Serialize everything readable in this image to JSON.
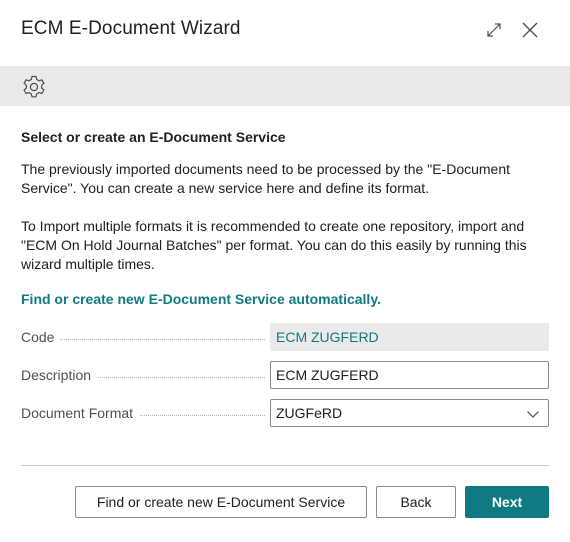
{
  "dialog": {
    "title": "ECM E-Document Wizard",
    "expand_icon": "expand-icon",
    "close_icon": "close-icon"
  },
  "toolbar": {
    "settings_icon": "gear-icon"
  },
  "content": {
    "heading": "Select or create an E-Document Service",
    "paragraph1": "The previously imported documents need to be processed by the \"E-Document Service\". You can create a new service here and define its format.",
    "paragraph2": "To Import multiple formats it is recommended to create one repository, import and \"ECM On Hold Journal Batches\" per format. You can do this easily by running this wizard multiple times.",
    "link": "Find or create new E-Document Service automatically."
  },
  "fields": {
    "code": {
      "label": "Code",
      "value": "ECM ZUGFERD"
    },
    "description": {
      "label": "Description",
      "value": "ECM ZUGFERD"
    },
    "document_format": {
      "label": "Document Format",
      "value": "ZUGFeRD"
    }
  },
  "actions": {
    "find_create": "Find or create new E-Document Service",
    "back": "Back",
    "next": "Next"
  },
  "colors": {
    "accent": "#0f7a83",
    "toolbar_bg": "#eaeaea",
    "text": "#212121"
  }
}
